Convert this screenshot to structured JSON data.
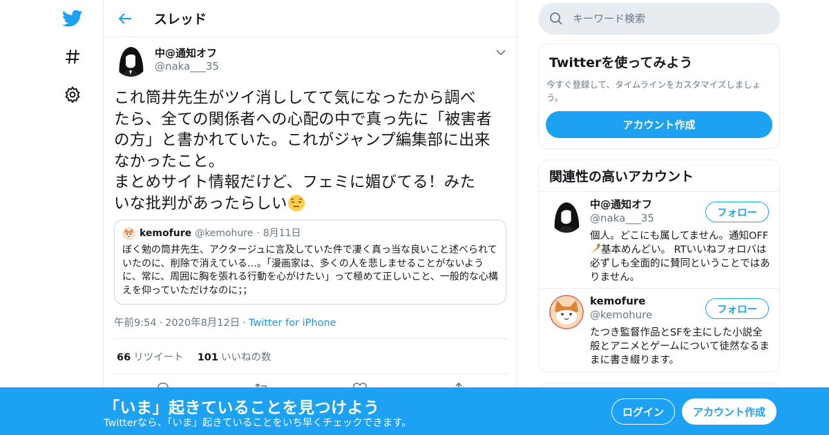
{
  "colors": {
    "brand": "#1da1f2",
    "text": "#14171a",
    "secondary": "#657786",
    "link": "#1b95e0",
    "border": "#e6ecf0"
  },
  "nav": {
    "icons": [
      "twitter-bird-icon",
      "hashtag-icon",
      "gear-icon"
    ]
  },
  "header": {
    "back_icon": "arrow-left-icon",
    "title": "スレッド"
  },
  "tweet": {
    "author_name": "中@通知オフ",
    "author_handle": "@naka___35",
    "text_lines": [
      "これ筒井先生がツイ消ししてて気になったから調べ",
      "たら、全ての関係者への心配の中で真っ先に「被害者",
      "の方」と書かれていた。これがジャンプ編集部に出来",
      "なかったこと。",
      "まとめサイト情報だけど、フェミに媚びてる！みた",
      "いな批判があったらしい"
    ],
    "emoji": "pensive-face-emoji",
    "quote": {
      "name": "kemofure",
      "handle": "@kemohure",
      "dot": "·",
      "date": "8月11日",
      "text": "ぼく勉の筒井先生、アクタージュに言及していた件で凄く真っ当な良いこと述べられていたのに、削除で消えている…。「漫画家は、多くの人を悲しませることがないように、常に、周囲に胸を張れる行動を心がけたい」って極めて正しいこと、一般的な心構えを仰っていただけなのに；；"
    },
    "time": "午前9:54",
    "date": "2020年8月12日",
    "dot": "·",
    "source": "Twitter for iPhone",
    "retweets_count": "66",
    "retweets_label": "リツイート",
    "likes_count": "101",
    "likes_label": "いいねの数",
    "action_icons": [
      "reply-icon",
      "retweet-icon",
      "like-icon",
      "share-icon"
    ]
  },
  "search": {
    "placeholder": "キーワード検索"
  },
  "signup_card": {
    "title": "Twitterを使ってみよう",
    "subtitle": "今すぐ登録して、タイムラインをカスタマイズしましょう。",
    "button": "アカウント作成"
  },
  "related": {
    "title": "関連性の高いアカウント",
    "users": [
      {
        "name": "中@通知オフ",
        "handle": "@naka___35",
        "follow": "フォロー",
        "bio_before": "個人。どこにも属してません。通知OFF",
        "bio_emoji": "carrot-emoji",
        "bio_after": "基本めんどい。 RTいいねフォロバは必ずしも全面的に賛同ということではありません。"
      },
      {
        "name": "kemofure",
        "handle": "@kemohure",
        "follow": "フォロー",
        "bio": "たつき監督作品とSFを主にした小説全般とアニメとゲームについて徒然なるままに書き綴ります。"
      }
    ]
  },
  "banner": {
    "title": "「いま」起きていることを見つけよう",
    "subtitle": "Twitterなら、「いま」起きていることをいち早くチェックできます。",
    "login": "ログイン",
    "signup": "アカウント作成"
  }
}
